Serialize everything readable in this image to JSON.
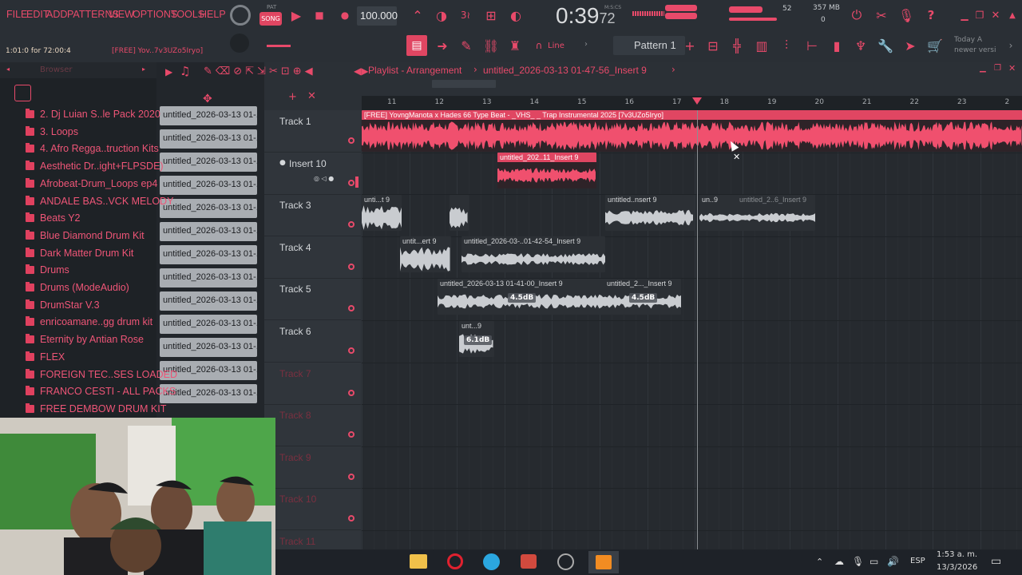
{
  "menu": [
    "FILE",
    "EDIT",
    "ADD",
    "PATTERNS",
    "VIEW",
    "OPTIONS",
    "TOOLS",
    "HELP"
  ],
  "transport": {
    "pat_label": "PAT",
    "song_label": "SONG",
    "tempo": "100.000",
    "time": "0:39",
    "time_frac": "72",
    "time_unit": "M:S:CS",
    "cpu_num": "52",
    "memory": "357 MB",
    "memory_sub": "0"
  },
  "hint_bar": {
    "position": "1:01:0 for 72:00:4",
    "title": "[FREE] Yov..7v3UZo5Iryo]"
  },
  "toolbar2": {
    "line_label": "Line",
    "pattern_label": "Pattern 1",
    "news_line1": "Today  A",
    "news_line2": "newer versi"
  },
  "browser": {
    "title": "Browser",
    "items": [
      "2. Dj Luian S..le Pack 2020",
      "3. Loops",
      "4. Afro Regga..truction Kits",
      "Aesthetic Dr..ight+FLPSDE)",
      "Afrobeat-Drum_Loops ep4",
      "ANDALE BAS..VCK MELODY",
      "Beats Y2",
      "Blue Diamond Drum Kit",
      "Dark Matter Drum Kit",
      "Drums",
      "Drums (ModeAudio)",
      "DrumStar V.3",
      "enricoamane..gg drum kit",
      "Eternity by Antian Rose",
      "FLEX",
      "FOREIGN TEC..SES LOADED",
      "FRANCO CESTI - ALL PACKS",
      "FREE DEMBOW DRUM KIT"
    ]
  },
  "clip_list": [
    "untitled_2026-03-13 01-...",
    "untitled_2026-03-13 01-...",
    "untitled_2026-03-13 01-...",
    "untitled_2026-03-13 01-...",
    "untitled_2026-03-13 01-...",
    "untitled_2026-03-13 01-...",
    "untitled_2026-03-13 01-...",
    "untitled_2026-03-13 01-...",
    "untitled_2026-03-13 01-...",
    "untitled_2026-03-13 01-...",
    "untitled_2026-03-13 01-...",
    "untitled_2026-03-13 01-...",
    "untitled_2026-03-13 01-..."
  ],
  "playlist": {
    "title": "Playlist - Arrangement",
    "sep": "›",
    "file": "untitled_2026-03-13 01-47-56_Insert 9",
    "ruler": [
      "11",
      "12",
      "13",
      "14",
      "15",
      "16",
      "17",
      "18",
      "19",
      "20",
      "21",
      "22",
      "23",
      "2"
    ],
    "tracks": [
      "Track 1",
      "Insert 10",
      "Track 3",
      "Track 4",
      "Track 5",
      "Track 6",
      "Track 7",
      "Track 8",
      "Track 9",
      "Track 10",
      "Track 11"
    ],
    "clips": {
      "t1": "[FREE] YovngManota x Hades 66 Type Beat - _VHS_ _ Trap Instrumental 2025 [7v3UZo5Iryo]",
      "t2": "untitled_202..11_Insert 9",
      "t3a": "unti...t 9",
      "t3c": "untitled..nsert 9",
      "t3d": "un..9",
      "t3e": "untitled_2..6_Insert 9",
      "t4a": "untit...ert 9",
      "t4b": "untitled_2026-03-..01-42-54_Insert 9",
      "t5a": "untitled_2026-03-13 01-41-00_Insert 9",
      "t5b": "untitled_2..._Insert 9",
      "t5_vol1": "4.5dB",
      "t5_vol2": "4.5dB",
      "t6": "unt...9",
      "t6_vol": "6.1dB"
    }
  },
  "taskbar": {
    "lang": "ESP",
    "time": "1:53 a. m.",
    "date": "13/3/2026"
  },
  "colors": {
    "accent": "#e84a6a",
    "bg": "#262a2f"
  }
}
